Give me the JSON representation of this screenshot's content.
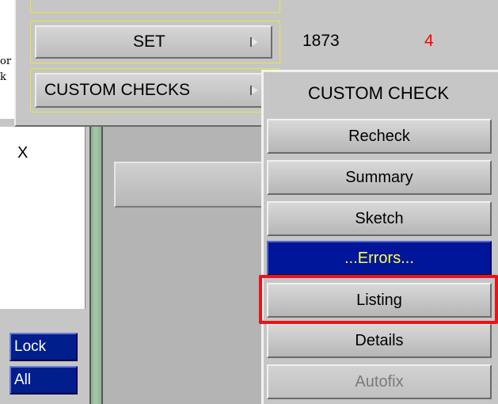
{
  "stray_text": {
    "line1": "or",
    "line2": "k"
  },
  "header": {
    "set_label": "SET",
    "set_count": "1873",
    "set_errors": "4",
    "custom_checks_label": "CUSTOM CHECKS"
  },
  "list": {
    "item": "X"
  },
  "sidebar": {
    "lock_label": "Lock",
    "all_label": "All"
  },
  "menu": {
    "title": "CUSTOM CHECK",
    "items": [
      {
        "label": "Recheck",
        "state": "normal"
      },
      {
        "label": "Summary",
        "state": "normal"
      },
      {
        "label": "Sketch",
        "state": "normal"
      },
      {
        "label": "...Errors...",
        "state": "selected"
      },
      {
        "label": "Listing",
        "state": "highlighted"
      },
      {
        "label": "Details",
        "state": "normal"
      },
      {
        "label": "Autofix",
        "state": "disabled"
      }
    ]
  },
  "colors": {
    "highlight": "#e8141a",
    "error_count": "#ff0000",
    "selected_bg": "#00169a",
    "selected_text": "#ffff44",
    "yellow_outline": "#e8e83a"
  }
}
